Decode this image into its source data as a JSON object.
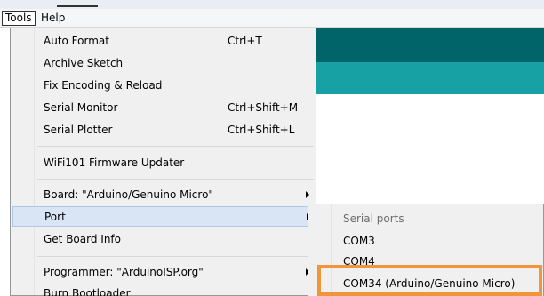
{
  "menubar": {
    "tools": "Tools",
    "help": "Help"
  },
  "tools_menu": {
    "items": [
      {
        "label": "Auto Format",
        "shortcut": "Ctrl+T"
      },
      {
        "label": "Archive Sketch",
        "shortcut": ""
      },
      {
        "label": "Fix Encoding & Reload",
        "shortcut": ""
      },
      {
        "label": "Serial Monitor",
        "shortcut": "Ctrl+Shift+M"
      },
      {
        "label": "Serial Plotter",
        "shortcut": "Ctrl+Shift+L"
      },
      {
        "label": "WiFi101 Firmware Updater",
        "shortcut": ""
      },
      {
        "label": "Board: \"Arduino/Genuino Micro\"",
        "shortcut": ""
      },
      {
        "label": "Port",
        "shortcut": ""
      },
      {
        "label": "Get Board Info",
        "shortcut": ""
      },
      {
        "label": "Programmer: \"ArduinoISP.org\"",
        "shortcut": ""
      },
      {
        "label": "Burn Bootloader",
        "shortcut": ""
      }
    ]
  },
  "port_submenu": {
    "header": "Serial ports",
    "items": [
      "COM3",
      "COM4",
      "COM34 (Arduino/Genuino Micro)"
    ]
  },
  "colors": {
    "teal_dark": "#006468",
    "teal_light": "#17a1a5",
    "highlight_box": "#f0953a",
    "menu_hover": "#d9e5f5"
  }
}
